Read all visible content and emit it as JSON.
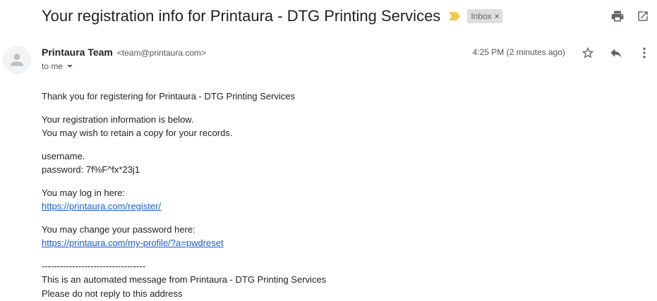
{
  "email": {
    "subject": "Your registration info for Printaura - DTG Printing Services",
    "label": "Inbox",
    "label_close": "×",
    "sender_name": "Printaura Team",
    "sender_email": "<team@printaura.com>",
    "recipient": "to me",
    "timestamp": "4:25 PM (2 minutes ago)",
    "colors": {
      "important_marker": "#f2c94c",
      "link": "#1a5ccf",
      "label_bg": "#dddddd"
    },
    "icons": [
      "print-icon",
      "open-in-new-window-icon",
      "star-icon",
      "reply-icon",
      "more-options-icon",
      "person-icon",
      "important-marker-icon"
    ]
  },
  "body": {
    "greeting": "Thank you for registering for Printaura - DTG Printing Services",
    "info_line1": "Your registration information is below.",
    "info_line2": "You may wish to retain a copy for your records.",
    "username": "username.",
    "password": "password: 7f%F^fx*23j1",
    "login_label": "You may log in here:",
    "login_link": "https://printaura.com/register/",
    "change_label": "You may change your password here:",
    "change_link": "https://printaura.com/my-profile/?a=pwdreset",
    "divider": "----------------------------------",
    "footer1": "This is an automated message from Printaura - DTG Printing Services",
    "footer2": "Please do not reply to this address"
  }
}
